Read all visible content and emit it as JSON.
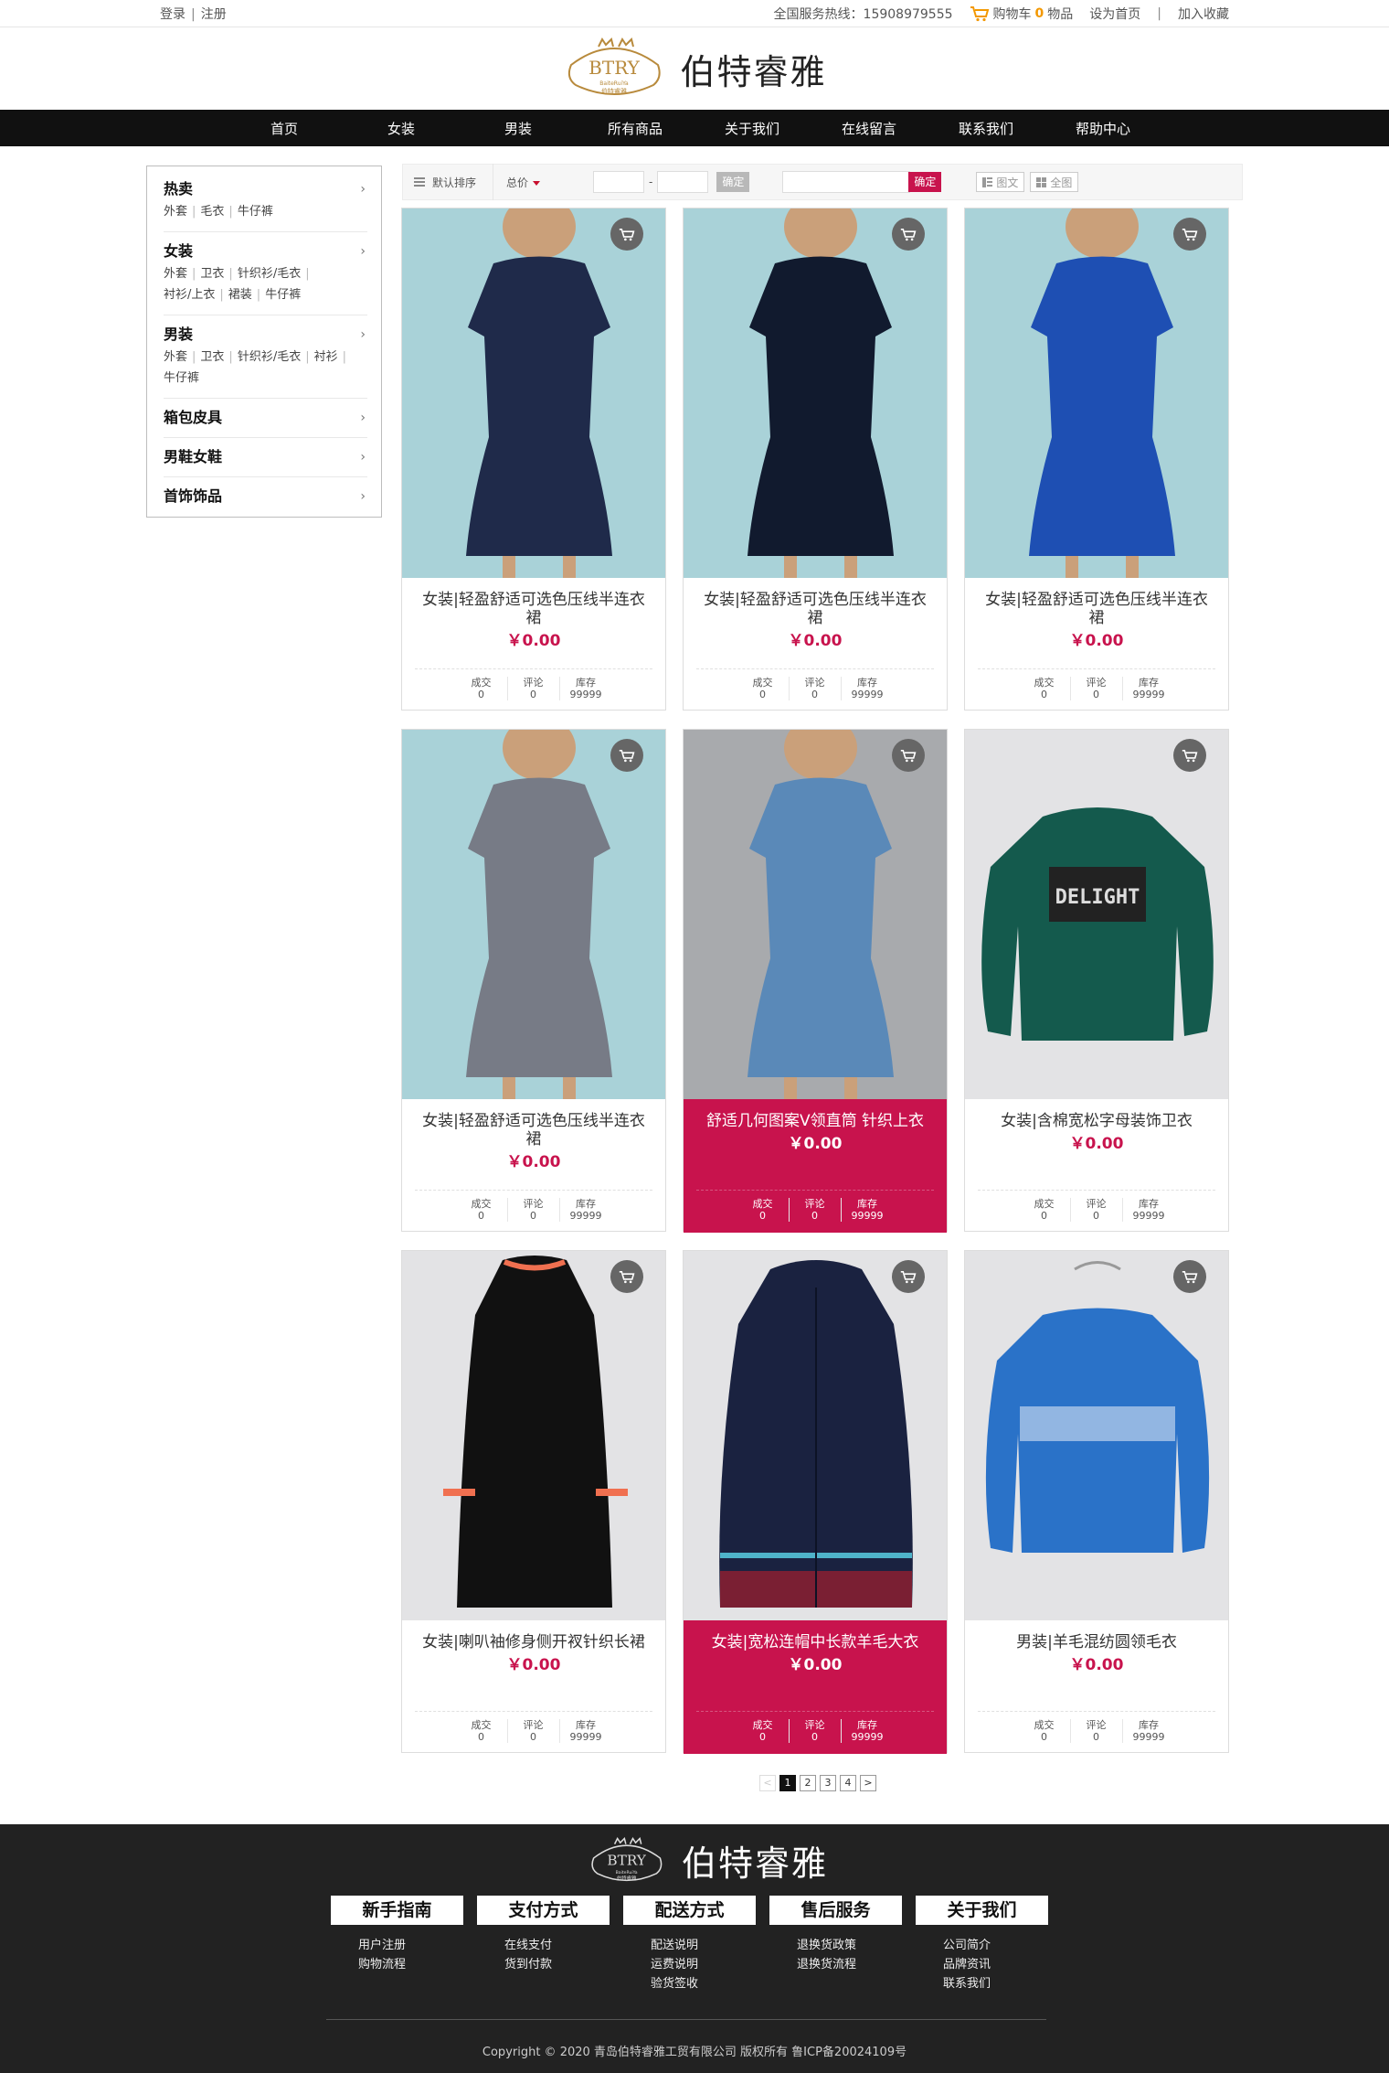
{
  "topbar": {
    "login": "登录",
    "register": "注册",
    "hotline": "全国服务热线：15908979555",
    "cart_prefix": "购物车",
    "cart_count": "0",
    "cart_suffix": "物品",
    "set_home": "设为首页",
    "add_fav": "加入收藏"
  },
  "brand": {
    "name": "伯特睿雅",
    "badge_text": "BTRY",
    "badge_small": "BaiteRuiYa",
    "badge_cn": "伯特睿雅"
  },
  "nav": [
    "首页",
    "女装",
    "男装",
    "所有商品",
    "关于我们",
    "在线留言",
    "联系我们",
    "帮助中心"
  ],
  "sidebar": [
    {
      "title": "热卖",
      "subs": [
        "外套",
        "毛衣",
        "牛仔裤"
      ]
    },
    {
      "title": "女装",
      "subs": [
        "外套",
        "卫衣",
        "针织衫/毛衣",
        "衬衫/上衣",
        "裙装",
        "牛仔裤"
      ]
    },
    {
      "title": "男装",
      "subs": [
        "外套",
        "卫衣",
        "针织衫/毛衣",
        "衬衫",
        "牛仔裤"
      ]
    },
    {
      "title": "箱包皮具",
      "subs": []
    },
    {
      "title": "男鞋女鞋",
      "subs": []
    },
    {
      "title": "首饰饰品",
      "subs": []
    }
  ],
  "filter": {
    "sort_label": "默认排序",
    "price_label": "总价",
    "range_sep": "-",
    "confirm": "确定",
    "search_confirm": "确定",
    "view_list": "图文",
    "view_grid": "全图"
  },
  "stats_labels": {
    "sold": "成交",
    "comments": "评论",
    "stock": "库存"
  },
  "products": [
    {
      "name": "女装|轻盈舒适可选色压线半连衣裙",
      "price": "￥0.00",
      "sold": "0",
      "comments": "0",
      "stock": "99999",
      "bg": "#a9d2d8",
      "garment": "#1f2a4a",
      "kind": "dress-tee"
    },
    {
      "name": "女装|轻盈舒适可选色压线半连衣裙",
      "price": "￥0.00",
      "sold": "0",
      "comments": "0",
      "stock": "99999",
      "bg": "#a9d2d8",
      "garment": "#111a2e",
      "kind": "dress-floral"
    },
    {
      "name": "女装|轻盈舒适可选色压线半连衣裙",
      "price": "￥0.00",
      "sold": "0",
      "comments": "0",
      "stock": "99999",
      "bg": "#a9d2d8",
      "garment": "#1e4fb3",
      "kind": "dress-blue"
    },
    {
      "name": "女装|轻盈舒适可选色压线半连衣裙",
      "price": "￥0.00",
      "sold": "0",
      "comments": "0",
      "stock": "99999",
      "bg": "#a9d2d8",
      "garment": "#777b86",
      "kind": "dress-stripe"
    },
    {
      "name": "舒适几何图案V领直筒 针织上衣",
      "price": "￥0.00",
      "sold": "0",
      "comments": "0",
      "stock": "99999",
      "bg": "#a8aaad",
      "garment": "#5a89b8",
      "kind": "dress-geo"
    },
    {
      "name": "女装|含棉宽松字母装饰卫衣",
      "price": "￥0.00",
      "sold": "0",
      "comments": "0",
      "stock": "99999",
      "bg": "#e3e3e5",
      "garment": "#145a4d",
      "kind": "sweatshirt"
    },
    {
      "name": "女装|喇叭袖修身侧开衩针织长裙",
      "price": "￥0.00",
      "sold": "0",
      "comments": "0",
      "stock": "99999",
      "bg": "#e3e3e5",
      "garment": "#111111",
      "kind": "long-dress"
    },
    {
      "name": "女装|宽松连帽中长款羊毛大衣",
      "price": "￥0.00",
      "sold": "0",
      "comments": "0",
      "stock": "99999",
      "bg": "#e3e3e5",
      "garment": "#1a2240",
      "kind": "coat"
    },
    {
      "name": "男装|羊毛混纺圆领毛衣",
      "price": "￥0.00",
      "sold": "0",
      "comments": "0",
      "stock": "99999",
      "bg": "#e3e3e5",
      "garment": "#2a72c8",
      "kind": "sweater"
    }
  ],
  "pagination": {
    "prev": "<",
    "pages": [
      "1",
      "2",
      "3",
      "4"
    ],
    "next": ">"
  },
  "footer": {
    "columns": [
      {
        "title": "新手指南",
        "items": [
          "用户注册",
          "购物流程"
        ]
      },
      {
        "title": "支付方式",
        "items": [
          "在线支付",
          "货到付款"
        ]
      },
      {
        "title": "配送方式",
        "items": [
          "配送说明",
          "运费说明",
          "验货签收"
        ]
      },
      {
        "title": "售后服务",
        "items": [
          "退换货政策",
          "退换货流程"
        ]
      },
      {
        "title": "关于我们",
        "items": [
          "公司简介",
          "品牌资讯",
          "联系我们"
        ]
      }
    ],
    "copyright": "Copyright © 2020 青岛伯特睿雅工贸有限公司 版权所有 鲁ICP备20024109号"
  }
}
